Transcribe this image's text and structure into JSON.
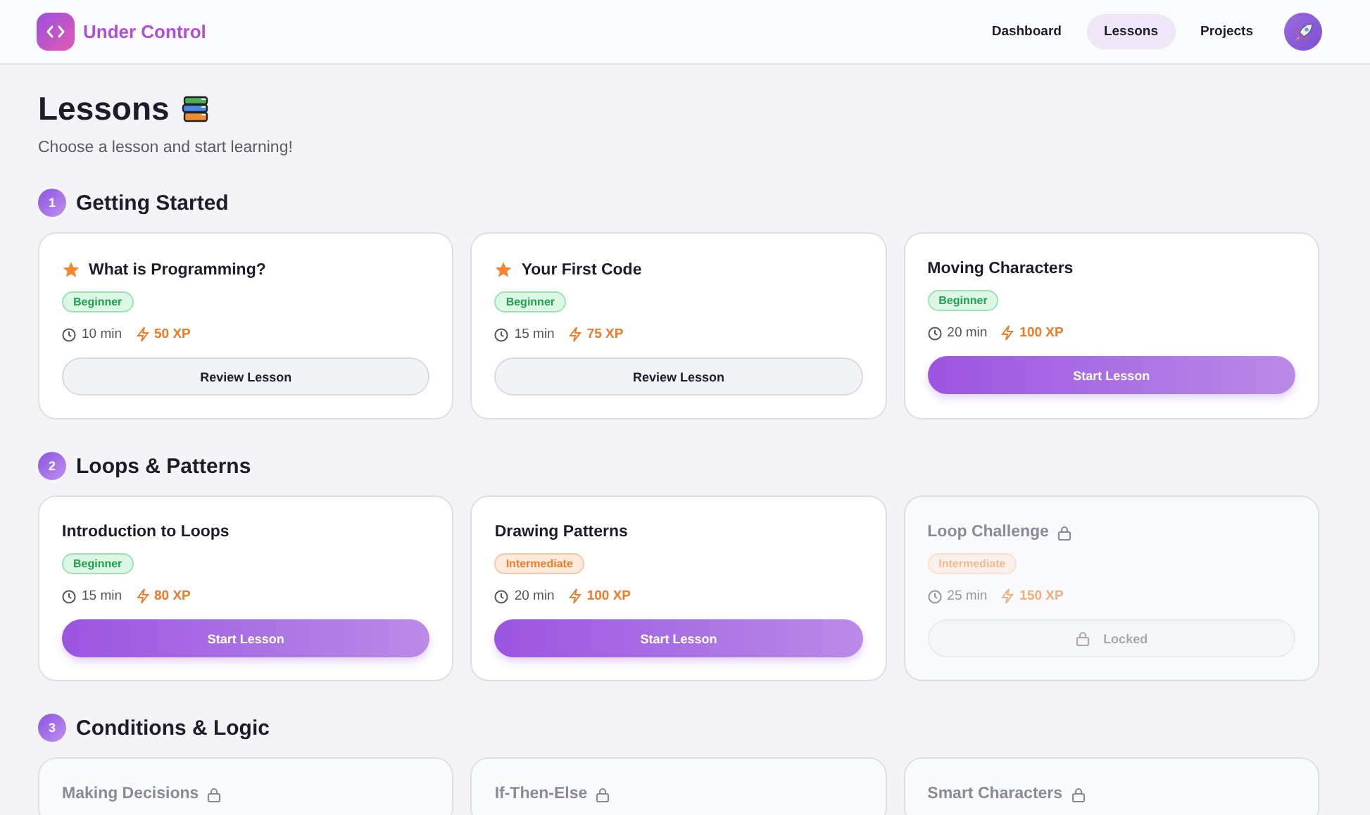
{
  "header": {
    "brand": "Under Control",
    "nav": [
      {
        "label": "Dashboard",
        "selected": false
      },
      {
        "label": "Lessons",
        "selected": true
      },
      {
        "label": "Projects",
        "selected": false
      }
    ]
  },
  "page": {
    "title": "Lessons",
    "subtitle": "Choose a lesson and start learning!"
  },
  "sections": [
    {
      "number": "1",
      "title": "Getting Started",
      "lessons": [
        {
          "title": "What is Programming?",
          "starred": true,
          "locked": false,
          "level": {
            "kind": "beginner",
            "label": "Beginner"
          },
          "duration": "10 min",
          "xp": "50 XP",
          "button": {
            "kind": "review",
            "label": "Review Lesson"
          }
        },
        {
          "title": "Your First Code",
          "starred": true,
          "locked": false,
          "level": {
            "kind": "beginner",
            "label": "Beginner"
          },
          "duration": "15 min",
          "xp": "75 XP",
          "button": {
            "kind": "review",
            "label": "Review Lesson"
          }
        },
        {
          "title": "Moving Characters",
          "starred": false,
          "locked": false,
          "level": {
            "kind": "beginner",
            "label": "Beginner"
          },
          "duration": "20 min",
          "xp": "100 XP",
          "button": {
            "kind": "start",
            "label": "Start Lesson"
          }
        }
      ]
    },
    {
      "number": "2",
      "title": "Loops & Patterns",
      "lessons": [
        {
          "title": "Introduction to Loops",
          "starred": false,
          "locked": false,
          "level": {
            "kind": "beginner",
            "label": "Beginner"
          },
          "duration": "15 min",
          "xp": "80 XP",
          "button": {
            "kind": "start",
            "label": "Start Lesson"
          }
        },
        {
          "title": "Drawing Patterns",
          "starred": false,
          "locked": false,
          "level": {
            "kind": "intermediate",
            "label": "Intermediate"
          },
          "duration": "20 min",
          "xp": "100 XP",
          "button": {
            "kind": "start",
            "label": "Start Lesson"
          }
        },
        {
          "title": "Loop Challenge",
          "starred": false,
          "locked": true,
          "level": {
            "kind": "intermediate",
            "label": "Intermediate"
          },
          "duration": "25 min",
          "xp": "150 XP",
          "button": {
            "kind": "locked",
            "label": "Locked"
          }
        }
      ]
    },
    {
      "number": "3",
      "title": "Conditions & Logic",
      "lessons": [
        {
          "title": "Making Decisions",
          "starred": false,
          "locked": true
        },
        {
          "title": "If-Then-Else",
          "starred": false,
          "locked": true
        },
        {
          "title": "Smart Characters",
          "starred": false,
          "locked": true
        }
      ]
    }
  ]
}
